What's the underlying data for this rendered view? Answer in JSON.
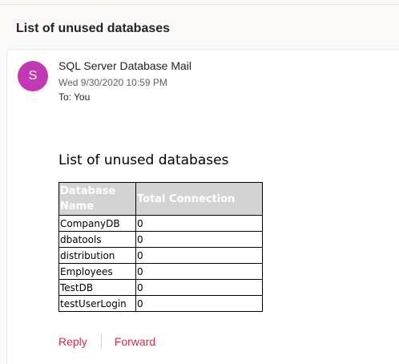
{
  "subject": "List of unused databases",
  "message": {
    "avatar_initial": "S",
    "avatar_color": "#c239b3",
    "sender": "SQL Server Database Mail",
    "date": "Wed 9/30/2020 10:59 PM",
    "to_label": "To:",
    "to_value": "You"
  },
  "body": {
    "title": "List of unused databases",
    "table": {
      "headers": [
        "Database Name",
        "Total Connection"
      ],
      "rows": [
        [
          "CompanyDB",
          "0"
        ],
        [
          "dbatools",
          "0"
        ],
        [
          "distribution",
          "0"
        ],
        [
          "Employees",
          "0"
        ],
        [
          "TestDB",
          "0"
        ],
        [
          "testUserLogin",
          "0"
        ]
      ]
    }
  },
  "actions": {
    "reply": "Reply",
    "forward": "Forward"
  },
  "colors": {
    "accent": "#c4314b",
    "header_fill": "#d3d3d3"
  }
}
